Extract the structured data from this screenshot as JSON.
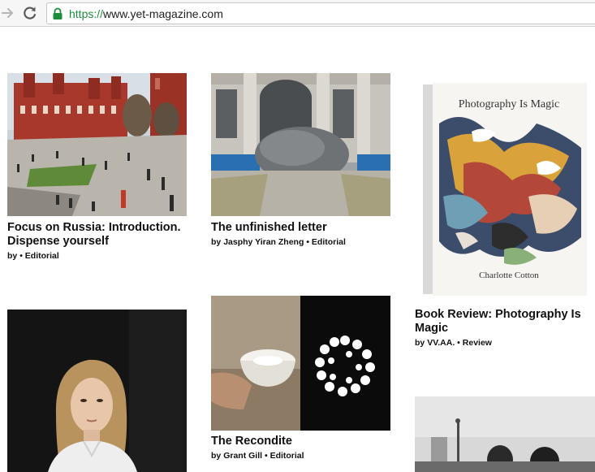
{
  "browser": {
    "url_scheme": "https://",
    "url_host": "www.yet-magazine.com"
  },
  "articles": [
    {
      "title": "Focus on Russia: Introduction. Dispense yourself",
      "author_prefix": "by",
      "separator": "•",
      "category": "Editorial"
    },
    {
      "title": "The unfinished letter",
      "author_prefix": "by",
      "author": "Jasphy Yiran Zheng",
      "separator": "•",
      "category": "Editorial"
    },
    {
      "title": "Book Review: Photography Is Magic",
      "author_prefix": "by",
      "author": "VV.AA.",
      "separator": "•",
      "category": "Review",
      "cover_title": "Photography Is Magic",
      "cover_author": "Charlotte Cotton"
    },
    {
      "title": "The Recondite",
      "author_prefix": "by",
      "author": "Grant Gill",
      "separator": "•",
      "category": "Editorial"
    }
  ],
  "colors": {
    "url_secure": "#1e8e3e",
    "text": "#111111"
  }
}
